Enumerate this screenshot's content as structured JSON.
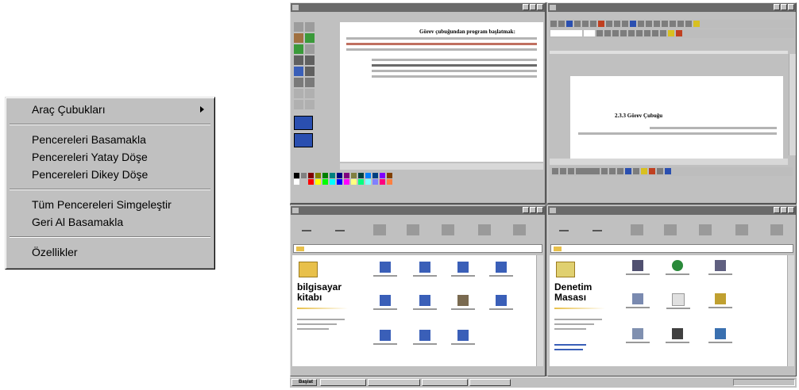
{
  "context_menu": {
    "items": [
      {
        "label": "Araç Çubukları",
        "has_submenu": true
      },
      {
        "label": "Pencereleri Basamakla"
      },
      {
        "label": "Pencereleri Yatay Döşe"
      },
      {
        "label": "Pencereleri Dikey Döşe"
      },
      {
        "label": "Tüm Pencereleri Simgeleştir"
      },
      {
        "label": "Geri Al Basamakla"
      },
      {
        "label": "Özellikler"
      }
    ]
  },
  "desktop": {
    "paint": {
      "heading": "Görev çubuğundan program başlatmak:"
    },
    "word": {
      "heading": "2.3.3 Görev Çubuğu"
    },
    "explorer": {
      "side_title": "bilgisayar kitabı"
    },
    "control_panel": {
      "side_title": "Denetim Masası"
    },
    "taskbar": {
      "start_label": "Başlat"
    },
    "colors": {
      "window_bg": "#c0c0c0",
      "titlebar": "#6a6a6a",
      "icon_blue": "#3a5fb8",
      "folder_yellow": "#e8c04a"
    }
  }
}
